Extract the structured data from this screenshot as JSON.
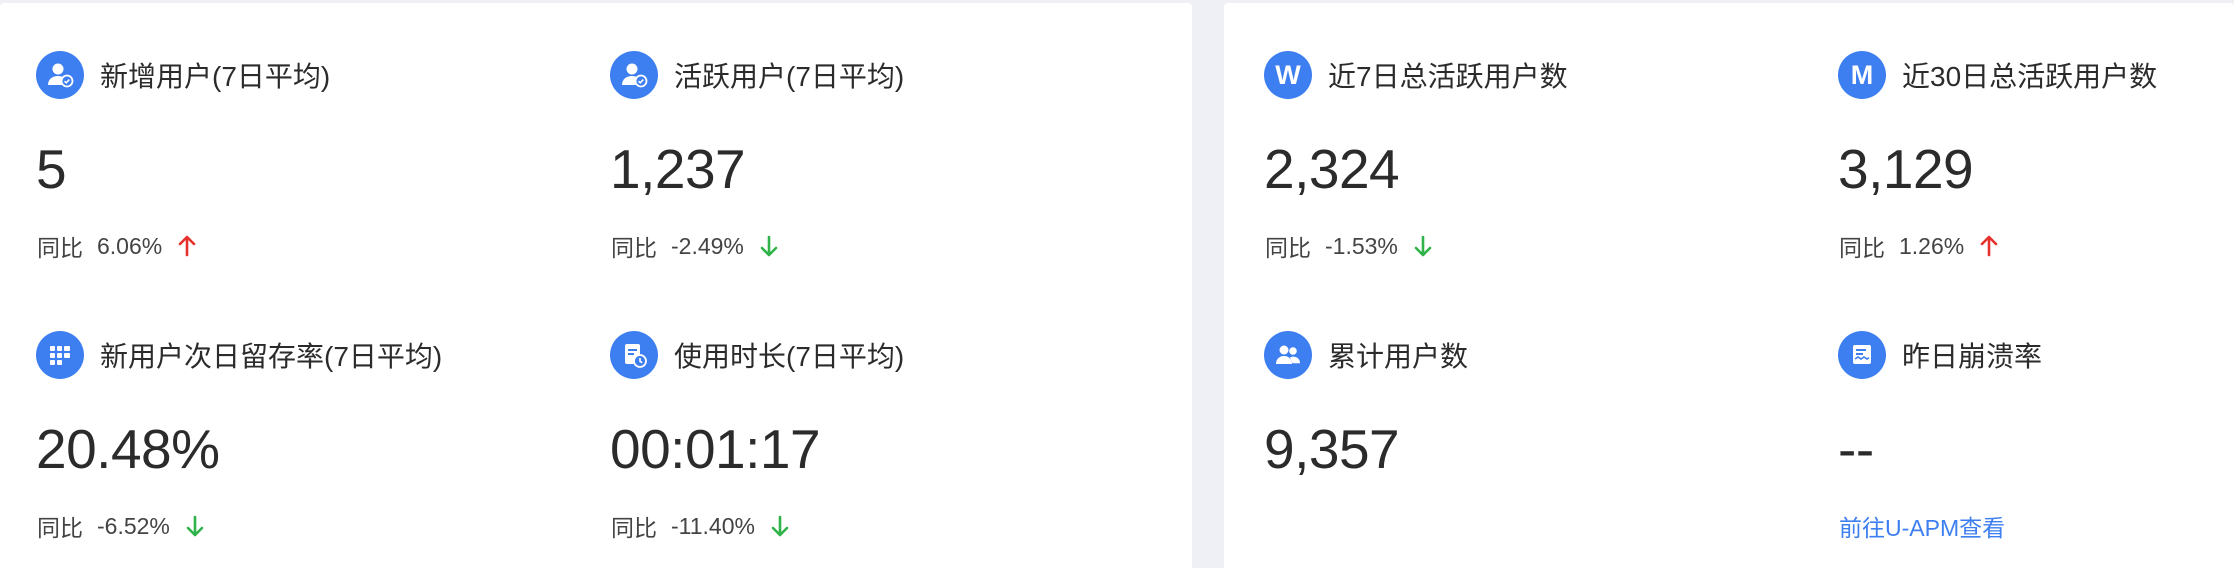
{
  "colors": {
    "accent": "#3d7ff0",
    "up": "#e5302e",
    "down": "#2fb34a"
  },
  "left": {
    "cards": [
      {
        "title": "新增用户(7日平均)",
        "value": "5",
        "compare_label": "同比",
        "compare_value": "6.06%",
        "trend": "up",
        "icon": "new-user-icon"
      },
      {
        "title": "活跃用户(7日平均)",
        "value": "1,237",
        "compare_label": "同比",
        "compare_value": "-2.49%",
        "trend": "down",
        "icon": "active-user-icon"
      },
      {
        "title": "新用户次日留存率(7日平均)",
        "value": "20.48%",
        "compare_label": "同比",
        "compare_value": "-6.52%",
        "trend": "down",
        "icon": "retention-grid-icon"
      },
      {
        "title": "使用时长(7日平均)",
        "value": "00:01:17",
        "compare_label": "同比",
        "compare_value": "-11.40%",
        "trend": "down",
        "icon": "duration-doc-icon"
      }
    ]
  },
  "right": {
    "cards": [
      {
        "title": "近7日总活跃用户数",
        "value": "2,324",
        "compare_label": "同比",
        "compare_value": "-1.53%",
        "trend": "down",
        "icon": "letter-w-icon",
        "icon_letter": "W"
      },
      {
        "title": "近30日总活跃用户数",
        "value": "3,129",
        "compare_label": "同比",
        "compare_value": "1.26%",
        "trend": "up",
        "icon": "letter-m-icon",
        "icon_letter": "M"
      },
      {
        "title": "累计用户数",
        "value": "9,357",
        "icon": "users-group-icon"
      },
      {
        "title": "昨日崩溃率",
        "value": "--",
        "link": "前往U-APM查看",
        "icon": "crash-report-icon"
      }
    ]
  }
}
